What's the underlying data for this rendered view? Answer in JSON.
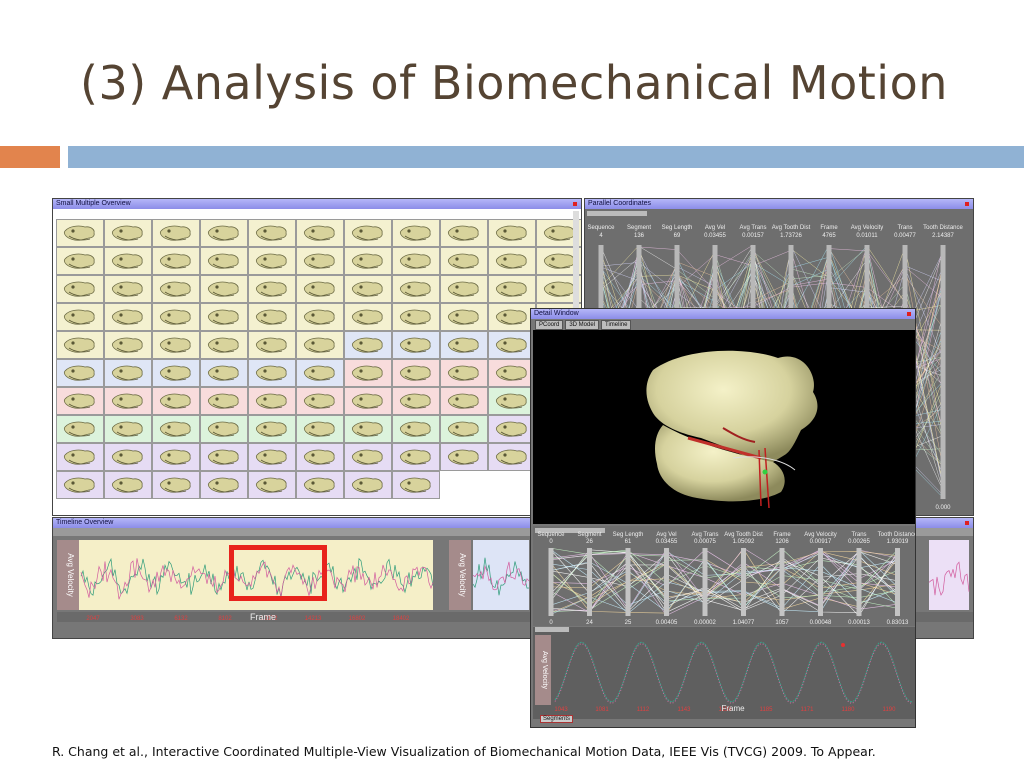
{
  "slide": {
    "title": "(3) Analysis of Biomechanical Motion",
    "citation": "R. Chang et al., Interactive Coordinated Multiple-View Visualization of Biomechanical Motion Data, IEEE Vis (TVCG) 2009.  To Appear."
  },
  "small_multiples": {
    "title": "Small Multiple Overview",
    "rows": [
      [
        "#f4f1d0",
        "#f4f1d0",
        "#f4f1d0",
        "#f4f1d0",
        "#f4f1d0",
        "#f4f1d0",
        "#f4f1d0",
        "#f4f1d0",
        "#f4f1d0",
        "#f4f1d0",
        "#f4f1d0"
      ],
      [
        "#f4f1d0",
        "#f4f1d0",
        "#f4f1d0",
        "#f4f1d0",
        "#f4f1d0",
        "#f4f1d0",
        "#f4f1d0",
        "#f4f1d0",
        "#f4f1d0",
        "#f4f1d0",
        "#f4f1d0"
      ],
      [
        "#f4f1d0",
        "#f4f1d0",
        "#f4f1d0",
        "#f4f1d0",
        "#f4f1d0",
        "#f4f1d0",
        "#f4f1d0",
        "#f4f1d0",
        "#f4f1d0",
        "#f4f1d0",
        "#f4f1d0"
      ],
      [
        "#f4f1d0",
        "#f4f1d0",
        "#f4f1d0",
        "#f4f1d0",
        "#f4f1d0",
        "#f4f1d0",
        "#f4f1d0",
        "#f4f1d0",
        "#f4f1d0",
        "#f4f1d0",
        "#f4f1d0"
      ],
      [
        "#f4f1d0",
        "#f4f1d0",
        "#f4f1d0",
        "#f4f1d0",
        "#f4f1d0",
        "#f4f1d0",
        "#dfe6f6",
        "#dfe6f6",
        "#dfe6f6",
        "#dfe6f6",
        "#dfe6f6"
      ],
      [
        "#dfe6f6",
        "#dfe6f6",
        "#dfe6f6",
        "#dfe6f6",
        "#dfe6f6",
        "#dfe6f6",
        "#f8dcdc",
        "#f8dcdc",
        "#f8dcdc",
        "#f8dcdc",
        "#f8dcdc"
      ],
      [
        "#f8dcdc",
        "#f8dcdc",
        "#f8dcdc",
        "#f8dcdc",
        "#f8dcdc",
        "#f8dcdc",
        "#f8dcdc",
        "#f8dcdc",
        "#f8dcdc",
        "#dcf3dc",
        "#dcf3dc"
      ],
      [
        "#dcf3dc",
        "#dcf3dc",
        "#dcf3dc",
        "#dcf3dc",
        "#dcf3dc",
        "#dcf3dc",
        "#dcf3dc",
        "#dcf3dc",
        "#dcf3dc",
        "#e6dcf4",
        "#e6dcf4"
      ],
      [
        "#e6dcf4",
        "#e6dcf4",
        "#e6dcf4",
        "#e6dcf4",
        "#e6dcf4",
        "#e6dcf4",
        "#e6dcf4",
        "#e6dcf4",
        "#e6dcf4",
        "#e6dcf4",
        "#e6dcf4"
      ],
      [
        "#e6dcf4",
        "#e6dcf4",
        "#e6dcf4",
        "#e6dcf4",
        "#e6dcf4",
        "#e6dcf4",
        "#e6dcf4",
        "#e6dcf4"
      ]
    ]
  },
  "parallel_coordinates": {
    "title": "Parallel Coordinates",
    "axes": [
      {
        "name": "Sequence",
        "top": "4"
      },
      {
        "name": "Segment",
        "top": "136"
      },
      {
        "name": "Seg Length",
        "top": "69"
      },
      {
        "name": "Avg Vel",
        "top": "0.03455"
      },
      {
        "name": "Avg Trans",
        "top": "0.00157"
      },
      {
        "name": "Avg Tooth Dist",
        "top": "1.73726"
      },
      {
        "name": "Frame",
        "top": "4765"
      },
      {
        "name": "Avg Velocity",
        "top": "0.01011"
      },
      {
        "name": "Trans",
        "top": "0.00477"
      },
      {
        "name": "Tooth Distance",
        "top": "2.14387"
      }
    ],
    "bottom_value": "0.000"
  },
  "timeline": {
    "title": "Timeline Overview",
    "ylabel": "Avg Velocity",
    "xlabel": "Frame",
    "ticks": [
      "2047",
      "3083",
      "6132",
      "8102",
      "10172",
      "14213",
      "16802",
      "18402"
    ]
  },
  "detail": {
    "title": "Detail Window",
    "tabs": [
      "PCoord",
      "3D Model",
      "Timeline"
    ],
    "pc_axes": [
      {
        "name": "Sequence",
        "top": "0",
        "bottom": "0"
      },
      {
        "name": "Segment",
        "top": "26",
        "bottom": "24"
      },
      {
        "name": "Seg Length",
        "top": "61",
        "bottom": "25"
      },
      {
        "name": "Avg Vel",
        "top": "0.03455",
        "bottom": "0.00405"
      },
      {
        "name": "Avg Trans",
        "top": "0.00075",
        "bottom": "0.00002"
      },
      {
        "name": "Avg Tooth Dist",
        "top": "1.05092",
        "bottom": "1.04077"
      },
      {
        "name": "Frame",
        "top": "1206",
        "bottom": "1057"
      },
      {
        "name": "Avg Velocity",
        "top": "0.00917",
        "bottom": "0.00048"
      },
      {
        "name": "Trans",
        "top": "0.00265",
        "bottom": "0.00013"
      },
      {
        "name": "Tooth Distance",
        "top": "1.93019",
        "bottom": "0.83013"
      }
    ],
    "ylabel": "Avg Velocity",
    "xlabel": "Frame",
    "ticks": [
      "1043",
      "1081",
      "1112",
      "1143",
      "1150",
      "1185",
      "1171",
      "1180",
      "1190"
    ],
    "segments_button": "Segments"
  },
  "colors": {
    "highlight": "#e8231c",
    "accent_orange": "#e2844d",
    "accent_blue": "#90b2d4"
  }
}
